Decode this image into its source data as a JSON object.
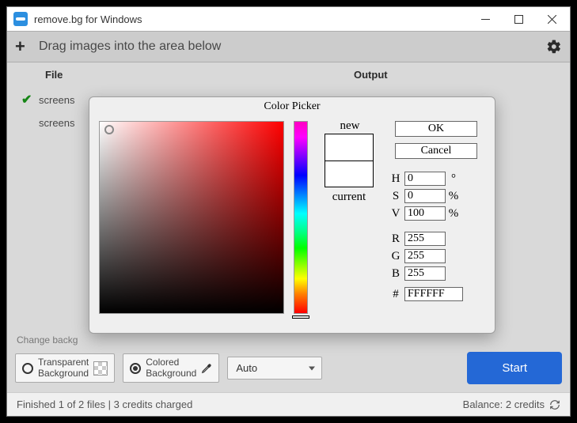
{
  "window": {
    "title": "remove.bg for Windows"
  },
  "toolbar": {
    "drag_hint": "Drag images into the area below"
  },
  "columns": {
    "file": "File",
    "output": "Output"
  },
  "rows": [
    {
      "name": "screens",
      "done": true
    },
    {
      "name": "screens",
      "done": false
    }
  ],
  "bg": {
    "change_label": "Change backg",
    "transparent": "Transparent\nBackground",
    "colored": "Colored\nBackground",
    "size": "Auto",
    "start": "Start"
  },
  "status": {
    "left": "Finished 1 of 2 files | 3 credits charged",
    "right": "Balance: 2 credits"
  },
  "picker": {
    "title": "Color Picker",
    "new": "new",
    "current": "current",
    "ok": "OK",
    "cancel": "Cancel",
    "H": "0",
    "S": "0",
    "V": "100",
    "R": "255",
    "G": "255",
    "B": "255",
    "hex": "FFFFFF",
    "deg": "°",
    "pct": "%"
  }
}
